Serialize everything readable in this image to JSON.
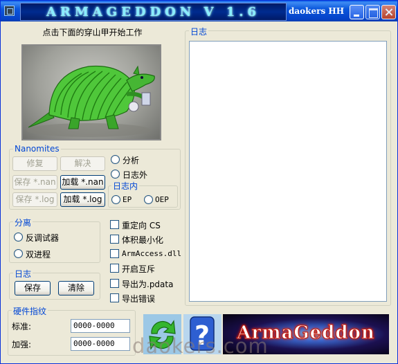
{
  "titlebar": {
    "banner": "ARMAGEDDON V 1.6",
    "title": "daokers HH"
  },
  "headline": "点击下面的穿山甲开始工作",
  "nanomites": {
    "title": "Nanomites",
    "buttons": {
      "repair": "修复",
      "decrypt": "解决",
      "save_nan": "保存 *.nan",
      "load_nan": "加载 *.nan",
      "save_log": "保存 *.log",
      "load_log": "加载 *.log"
    },
    "options": {
      "analyze": "分析",
      "outside_log": "日志外"
    },
    "inside_log": {
      "title": "日志内",
      "ep": "EP",
      "oep": "OEP"
    }
  },
  "separation": {
    "title": "分离",
    "anti_debugger": "反调试器",
    "dual_process": "双进程"
  },
  "log_group": {
    "title": "日志",
    "save": "保存",
    "clear": "清除"
  },
  "checkboxes": {
    "redirect_cs": "重定向 CS",
    "minimize_size": "体积最小化",
    "armaccess": "ArmAccess.dll",
    "mutex": "开启互斥",
    "export_pdata": "导出为.pdata",
    "export_errors": "导出错误"
  },
  "hardware": {
    "title": "硬件指纹",
    "standard_label": "标准:",
    "standard_value": "0000-0000",
    "enhanced_label": "加强:",
    "enhanced_value": "0000-0000"
  },
  "log_panel": {
    "title": "日志"
  },
  "bottom": {
    "banner": "ArmaGeddon",
    "watermark": "daokers.com"
  },
  "icons": [
    "app-icon",
    "armadillo-image",
    "refresh-icon",
    "help-icon"
  ],
  "colors": {
    "group_title": "#0046d5",
    "window_bg": "#ece9d8",
    "titlebar": "#0b57dc"
  }
}
